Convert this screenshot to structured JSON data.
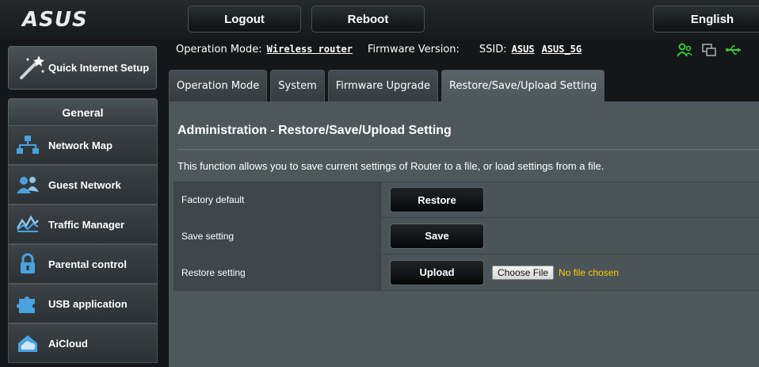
{
  "header": {
    "logo_text": "ASUS",
    "logout_label": "Logout",
    "reboot_label": "Reboot",
    "language_label": "English"
  },
  "sidebar": {
    "quick_setup_label": "Quick Internet Setup",
    "section_title": "General",
    "items": [
      {
        "label": "Network Map",
        "icon": "network-map-icon"
      },
      {
        "label": "Guest Network",
        "icon": "guest-network-icon"
      },
      {
        "label": "Traffic Manager",
        "icon": "traffic-manager-icon"
      },
      {
        "label": "Parental control",
        "icon": "parental-control-icon"
      },
      {
        "label": "USB application",
        "icon": "usb-application-icon"
      },
      {
        "label": "AiCloud",
        "icon": "aicloud-icon"
      }
    ]
  },
  "status": {
    "operation_mode_label": "Operation Mode:",
    "operation_mode_value": "Wireless router",
    "firmware_label": "Firmware Version:",
    "firmware_value": "",
    "ssid_label": "SSID:",
    "ssid_values": [
      "ASUS",
      "ASUS_5G"
    ],
    "icons": [
      "clients-icon",
      "devices-icon",
      "usb-icon"
    ]
  },
  "tabs": [
    {
      "label": "Operation Mode",
      "active": false
    },
    {
      "label": "System",
      "active": false
    },
    {
      "label": "Firmware Upgrade",
      "active": false
    },
    {
      "label": "Restore/Save/Upload Setting",
      "active": true
    }
  ],
  "main": {
    "title": "Administration - Restore/Save/Upload Setting",
    "description": "This function allows you to save current settings of Router to a file, or load settings from a file.",
    "rows": [
      {
        "label": "Factory default",
        "button": "Restore"
      },
      {
        "label": "Save setting",
        "button": "Save"
      },
      {
        "label": "Restore setting",
        "button": "Upload",
        "file_button": "Choose File",
        "file_status": "No file chosen"
      }
    ]
  },
  "colors": {
    "accent_green": "#33cc33",
    "file_status": "#ffcc00",
    "panel_bg": "#4e585c"
  }
}
